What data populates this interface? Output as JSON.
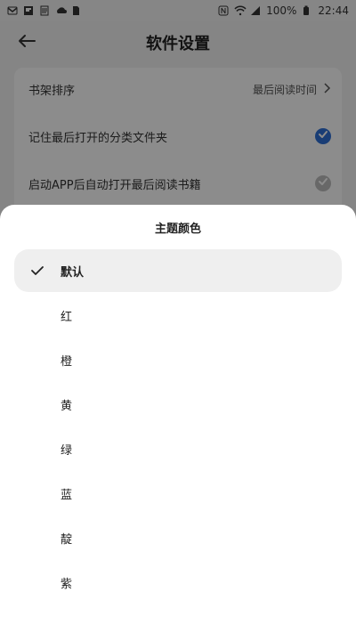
{
  "status_bar": {
    "battery_percent": "100%",
    "time": "22:44"
  },
  "header": {
    "title": "软件设置"
  },
  "settings": {
    "sort_label": "书架排序",
    "sort_value": "最后阅读时间",
    "remember_folder_label": "记住最后打开的分类文件夹",
    "remember_folder_checked": true,
    "auto_open_label": "启动APP后自动打开最后阅读书籍",
    "auto_open_checked": false
  },
  "theme_sheet": {
    "title": "主题颜色",
    "options": [
      {
        "label": "默认",
        "selected": true
      },
      {
        "label": "红",
        "selected": false
      },
      {
        "label": "橙",
        "selected": false
      },
      {
        "label": "黄",
        "selected": false
      },
      {
        "label": "绿",
        "selected": false
      },
      {
        "label": "蓝",
        "selected": false
      },
      {
        "label": "靛",
        "selected": false
      },
      {
        "label": "紫",
        "selected": false
      }
    ]
  },
  "colors": {
    "accent_blue": "#2f6fd6",
    "scrim": "rgba(0,0,0,0.45)"
  }
}
